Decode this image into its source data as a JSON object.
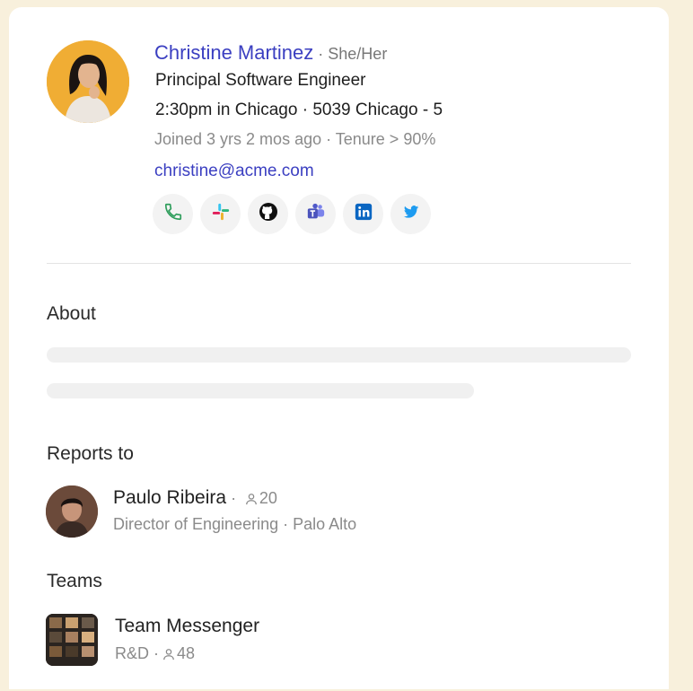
{
  "profile": {
    "name": "Christine Martinez",
    "pronouns": " · She/Her",
    "title": "Principal Software Engineer",
    "location": "2:30pm in Chicago · 5039 Chicago - 5",
    "joined": "Joined 3 yrs 2 mos ago · Tenure > 90%",
    "email": "christine@acme.com",
    "contact_icons": [
      "phone-icon",
      "slack-icon",
      "github-icon",
      "teams-icon",
      "linkedin-icon",
      "twitter-icon"
    ]
  },
  "about": {
    "heading": "About"
  },
  "reports_to": {
    "heading": "Reports to",
    "name": "Paulo Ribeira",
    "separator": " ·",
    "count": "20",
    "subtitle": "Director of Engineering · Palo Alto"
  },
  "teams": {
    "heading": "Teams",
    "items": [
      {
        "name": "Team Messenger",
        "dept": "R&D ·",
        "count": "48"
      }
    ]
  },
  "colors": {
    "background": "#f8f0dc",
    "link": "#3b3fc1",
    "muted": "#8a8a8a"
  }
}
